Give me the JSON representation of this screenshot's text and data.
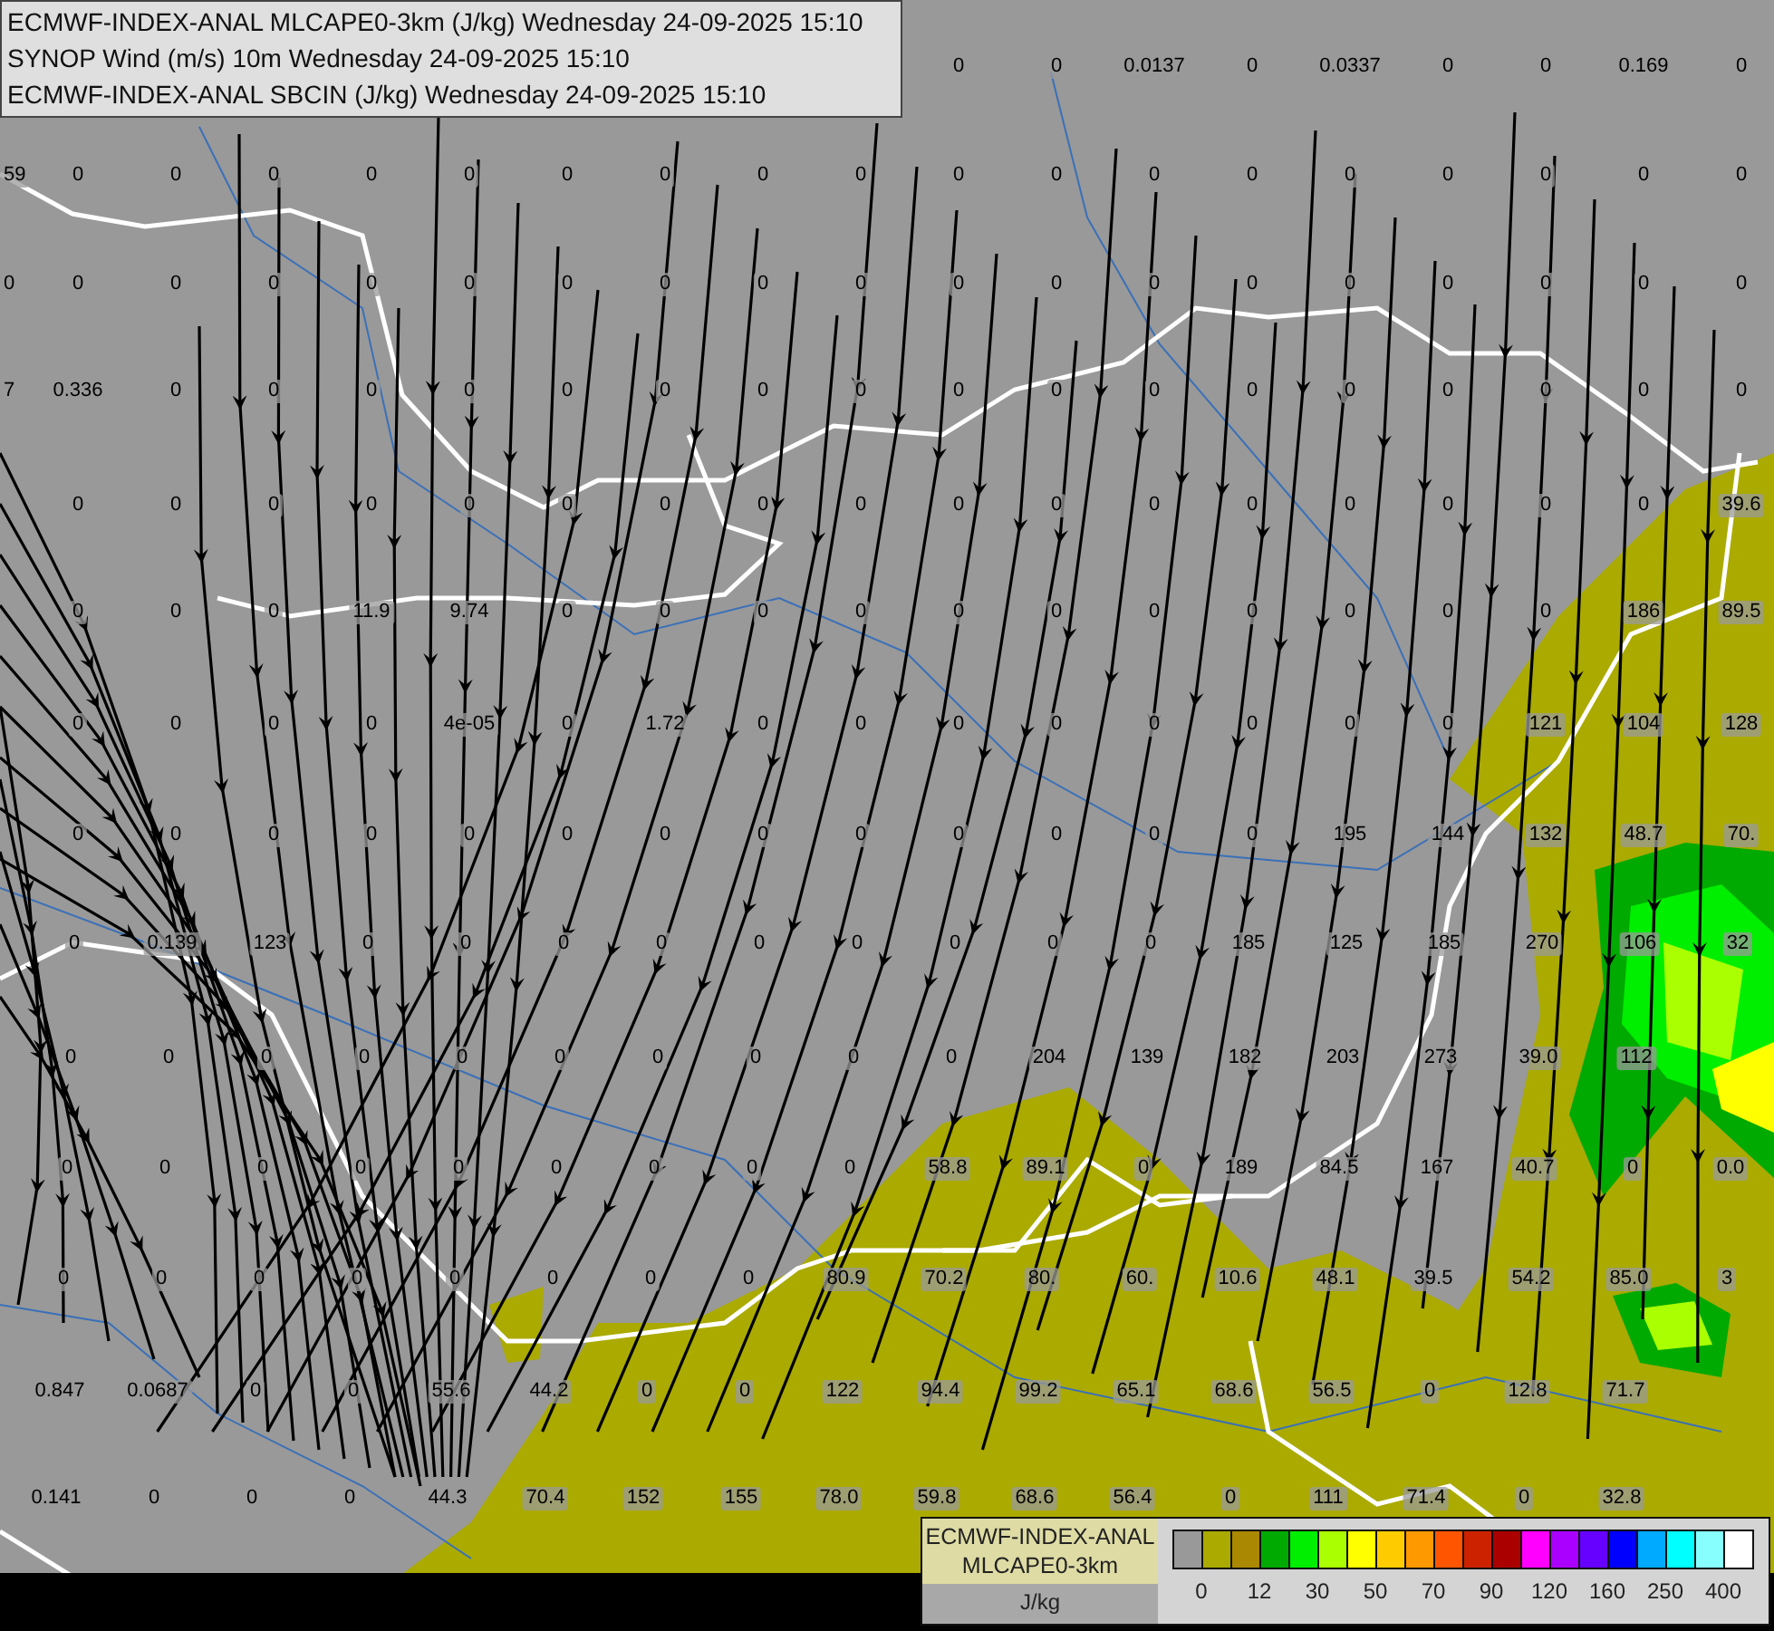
{
  "header": {
    "lines": [
      "ECMWF-INDEX-ANAL MLCAPE0-3km (J/kg) Wednesday 24-09-2025 15:10",
      "SYNOP Wind (m/s) 10m Wednesday 24-09-2025 15:10",
      "ECMWF-INDEX-ANAL SBCIN (J/kg) Wednesday 24-09-2025 15:10"
    ]
  },
  "station_values": {
    "rows": [
      [
        null,
        null,
        null,
        null,
        null,
        null,
        null,
        null,
        null,
        null,
        "0",
        "0",
        "0.0137",
        "0",
        "0.0337",
        "0",
        "0",
        "0.169",
        "0"
      ],
      [
        "59",
        "0",
        "0",
        "0",
        "0",
        "0",
        "0",
        "0",
        "0",
        "0",
        "0",
        "0",
        "0",
        "0",
        "0",
        "0",
        "0",
        "0",
        "0"
      ],
      [
        "0",
        "0",
        "0",
        "0",
        "0",
        "0",
        "0",
        "0",
        "0",
        "0",
        "0",
        "0",
        "0",
        "0",
        "0",
        "0",
        "0",
        "0",
        "0"
      ],
      [
        "7",
        "0.336",
        "0",
        "0",
        "0",
        "0",
        "0",
        "0",
        "0",
        "0",
        "0",
        "0",
        "0",
        "0",
        "0",
        "0",
        "0",
        "0",
        "0"
      ],
      [
        null,
        "0",
        "0",
        "0",
        "0",
        "0",
        "0",
        "0",
        "0",
        "0",
        "0",
        "0",
        "0",
        "0",
        "0",
        "0",
        "0",
        "0",
        "39.6"
      ],
      [
        null,
        "0",
        "0",
        "0",
        "11.9",
        "9.74",
        "0",
        "0",
        "0",
        "0",
        "0",
        "0",
        "0",
        "0",
        "0",
        "0",
        "0",
        "186",
        "89.5"
      ],
      [
        null,
        "0",
        "0",
        "0",
        "0",
        "4e-05",
        "0",
        "1.72",
        "0",
        "0",
        "0",
        "0",
        "0",
        "0",
        "0",
        "0",
        "121",
        "104",
        "128"
      ],
      [
        null,
        "0",
        "0",
        "0",
        "0",
        "0",
        "0",
        "0",
        "0",
        "0",
        "0",
        "0",
        "0",
        "0",
        "195",
        "144",
        "132",
        "48.7",
        "70."
      ],
      [
        null,
        "0",
        "0.139",
        "123",
        "0",
        "0",
        "0",
        "0",
        "0",
        "0",
        "0",
        "0",
        "0",
        "185",
        "125",
        "185",
        "270",
        "106",
        "32"
      ],
      [
        null,
        "0",
        "0",
        "0",
        "0",
        "0",
        "0",
        "0",
        "0",
        "0",
        "0",
        "204",
        "139",
        "182",
        "203",
        "273",
        "39.0",
        "112",
        null
      ],
      [
        null,
        "0",
        "0",
        "0",
        "0",
        "0",
        "0",
        "0",
        "0",
        "0",
        "58.8",
        "89.1",
        "0",
        "189",
        "84.5",
        "167",
        "40.7",
        "0",
        "0.0"
      ],
      [
        null,
        "0",
        "0",
        "0",
        "0",
        "0",
        "0",
        "0",
        "0",
        "80.9",
        "70.2",
        "80.",
        "60.",
        "10.6",
        "48.1",
        "39.5",
        "54.2",
        "85.0",
        "3"
      ],
      [
        null,
        "0.847",
        "0.0687",
        "0",
        "0",
        "55.6",
        "44.2",
        "0",
        "0",
        "122",
        "94.4",
        "99.2",
        "65.1",
        "68.6",
        "56.5",
        "0",
        "12.8",
        "71.7",
        null
      ],
      [
        null,
        "0.141",
        "0",
        "0",
        "0",
        "44.3",
        "70.4",
        "152",
        "155",
        "78.0",
        "59.8",
        "68.6",
        "56.4",
        "0",
        "111",
        "71.4",
        "0",
        "32.8",
        null
      ]
    ]
  },
  "colorbar": {
    "title_lines": [
      "ECMWF-INDEX-ANAL",
      "MLCAPE0-3km"
    ],
    "unit": "J/kg",
    "colors": [
      {
        "color": "#999999"
      },
      {
        "color": "#aaaa00"
      },
      {
        "color": "#aa8800"
      },
      {
        "color": "#00aa00"
      },
      {
        "color": "#00ee00"
      },
      {
        "color": "#aaff00"
      },
      {
        "color": "#ffff00"
      },
      {
        "color": "#ffcc00"
      },
      {
        "color": "#ff9900"
      },
      {
        "color": "#ff5500"
      },
      {
        "color": "#cc2200"
      },
      {
        "color": "#aa0000"
      },
      {
        "color": "#ff00ff"
      },
      {
        "color": "#aa00ff"
      },
      {
        "color": "#6600ff"
      },
      {
        "color": "#0000ff"
      },
      {
        "color": "#00aaff"
      },
      {
        "color": "#00ffff"
      },
      {
        "color": "#88ffff"
      },
      {
        "color": "#ffffff"
      }
    ],
    "ticks": [
      "0",
      "12",
      "30",
      "50",
      "70",
      "90",
      "120",
      "160",
      "250",
      "400"
    ]
  }
}
